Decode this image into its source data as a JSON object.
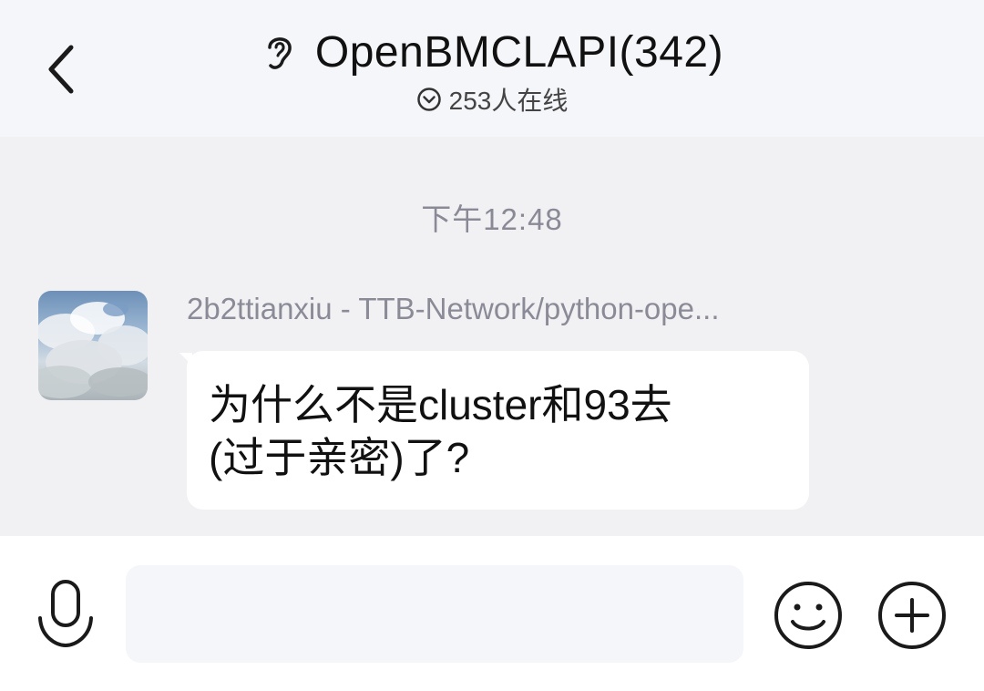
{
  "header": {
    "title": "OpenBMCLAPI(342)",
    "online_count": "253人在线",
    "icons": {
      "back": "back-chevron-icon",
      "ear": "ear-icon",
      "online": "chevron-down-circle-icon"
    }
  },
  "chat": {
    "messages": [
      {
        "timestamp": "下午12:48",
        "sender": "2b2ttianxiu - TTB-Network/python-ope...",
        "text_lines": [
          "为什么不是cluster和93去",
          "(过于亲密)了?"
        ],
        "avatar": "sky-clouds-avatar"
      }
    ]
  },
  "input_bar": {
    "message_value": "",
    "icons": {
      "voice": "microphone-icon",
      "emoji": "smiley-icon",
      "more": "plus-circle-icon"
    }
  },
  "colors": {
    "header_bg": "#f5f6fa",
    "chat_bg": "#f1f1f4",
    "bubble_bg": "#ffffff",
    "meta_text": "#8b8b97"
  }
}
